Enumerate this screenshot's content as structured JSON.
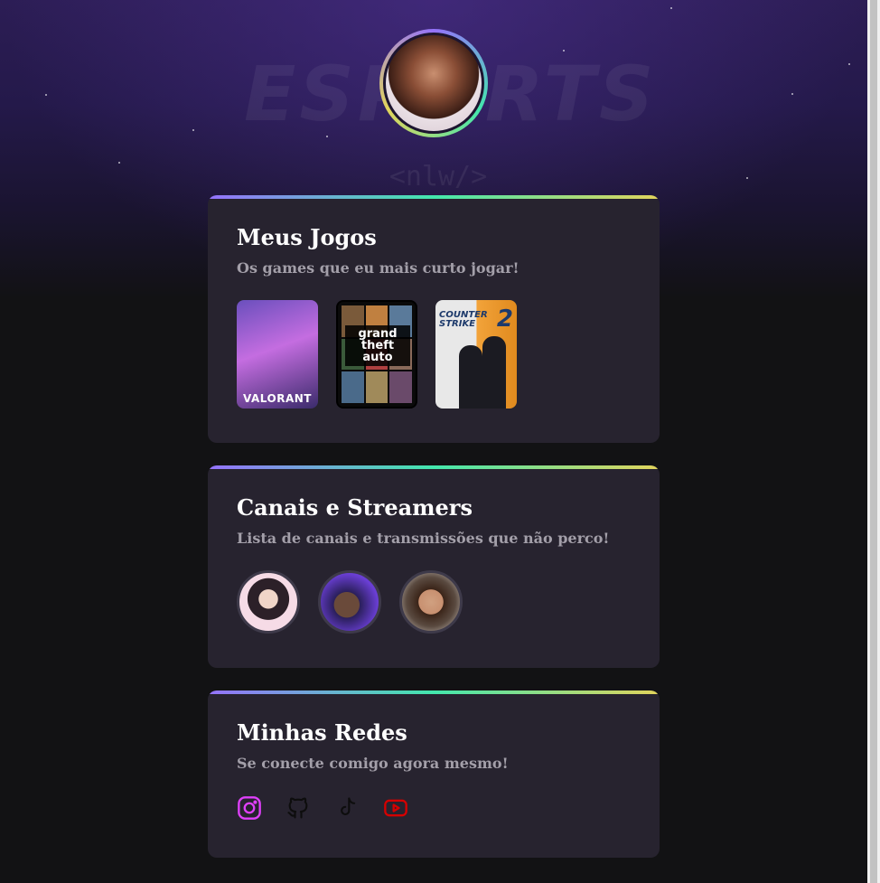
{
  "profile": {
    "avatar_alt": "Foto de perfil"
  },
  "hero": {
    "bg_text": "ESPORTS",
    "bg_sub": "<nlw/>"
  },
  "cards": {
    "games": {
      "title": "Meus Jogos",
      "subtitle": "Os games que eu mais curto jogar!",
      "items": [
        {
          "name": "VALORANT",
          "label": "VALORANT"
        },
        {
          "name": "Grand Theft Auto V",
          "label": "grand theft auto"
        },
        {
          "name": "Counter-Strike 2",
          "label": "COUNTER STRIKE",
          "number": "2"
        }
      ]
    },
    "streamers": {
      "title": "Canais e Streamers",
      "subtitle": "Lista de canais e transmissões que não perco!"
    },
    "socials": {
      "title": "Minhas Redes",
      "subtitle": "Se conecte comigo agora mesmo!",
      "items": [
        {
          "icon": "instagram-icon",
          "color": "#e040fb"
        },
        {
          "icon": "github-icon",
          "color": "#0d0d0d"
        },
        {
          "icon": "tiktok-icon",
          "color": "#0d0d0d"
        },
        {
          "icon": "youtube-icon",
          "color": "#d50000"
        }
      ]
    }
  },
  "colors": {
    "background": "#121214",
    "card": "#27232f",
    "accent_gradient": [
      "#9572fc",
      "#43e7ad",
      "#e2d45c"
    ],
    "title": "#ffffff",
    "subtitle": "#a39fa9"
  }
}
